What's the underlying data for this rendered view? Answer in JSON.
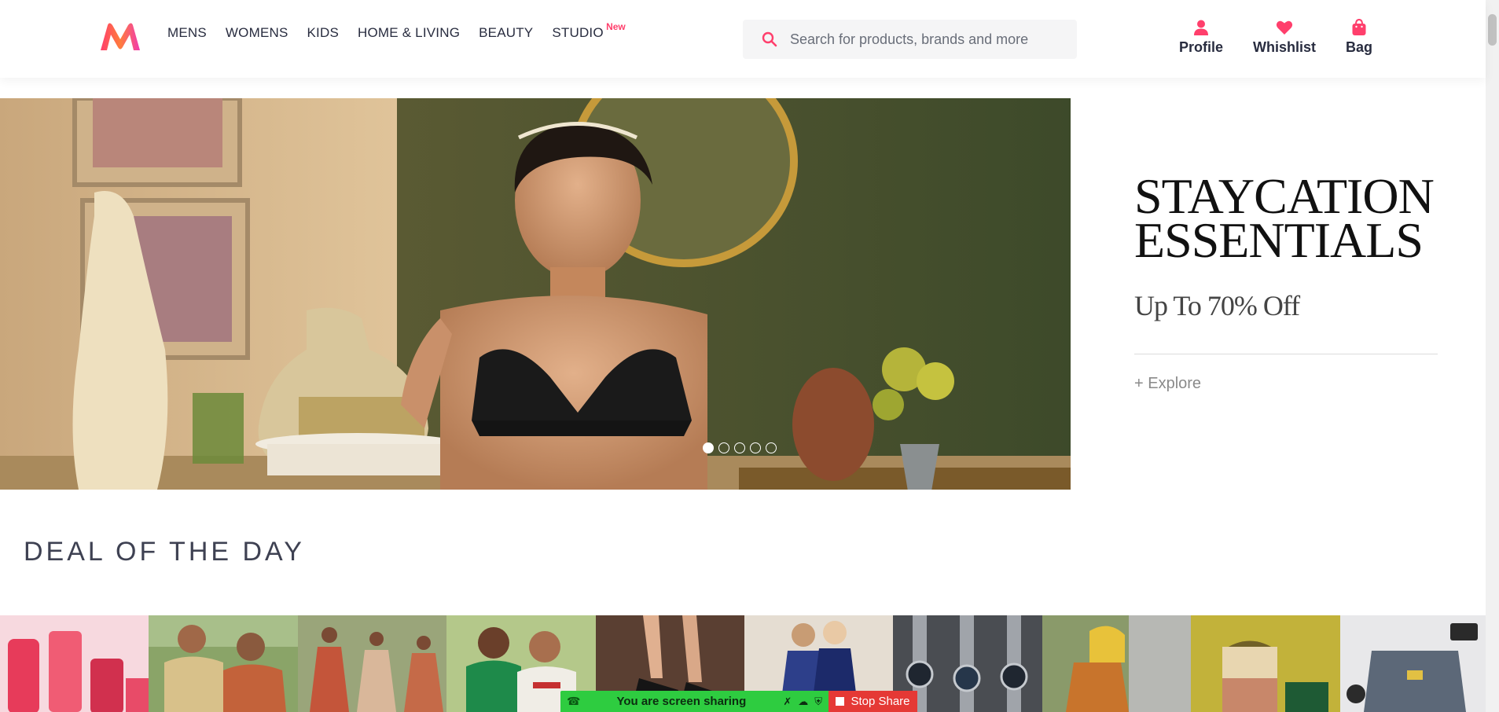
{
  "header": {
    "logo_alt": "Myntra",
    "nav": [
      {
        "label": "MENS"
      },
      {
        "label": "WOMENS"
      },
      {
        "label": "KIDS"
      },
      {
        "label": "HOME & LIVING"
      },
      {
        "label": "BEAUTY"
      },
      {
        "label": "STUDIO",
        "badge": "New"
      }
    ],
    "search_placeholder": "Search for products, brands and more",
    "actions": [
      {
        "label": "Profile",
        "icon": "profile-icon"
      },
      {
        "label": "Whishlist",
        "icon": "heart-icon"
      },
      {
        "label": "Bag",
        "icon": "bag-icon"
      }
    ],
    "accent_color": "#ff3f6c"
  },
  "hero": {
    "title_line1": "STAYCATION",
    "title_line2": "ESSENTIALS",
    "subtitle": "Up To 70% Off",
    "cta": "+ Explore",
    "slides_total": 5,
    "active_slide": 1
  },
  "deals": {
    "title": "DEAL OF THE DAY",
    "tiles": [
      {
        "name": "body-care-tile"
      },
      {
        "name": "mens-shirts-tile"
      },
      {
        "name": "ethnic-wear-tile"
      },
      {
        "name": "casual-tees-tile"
      },
      {
        "name": "heels-tile"
      },
      {
        "name": "kids-dresses-tile"
      },
      {
        "name": "watches-tile"
      },
      {
        "name": "handbags-tile"
      },
      {
        "name": "bags-tile"
      },
      {
        "name": "accessories-tile"
      }
    ]
  },
  "screen_share": {
    "status": "You are screen sharing",
    "stop_label": "Stop Share"
  }
}
